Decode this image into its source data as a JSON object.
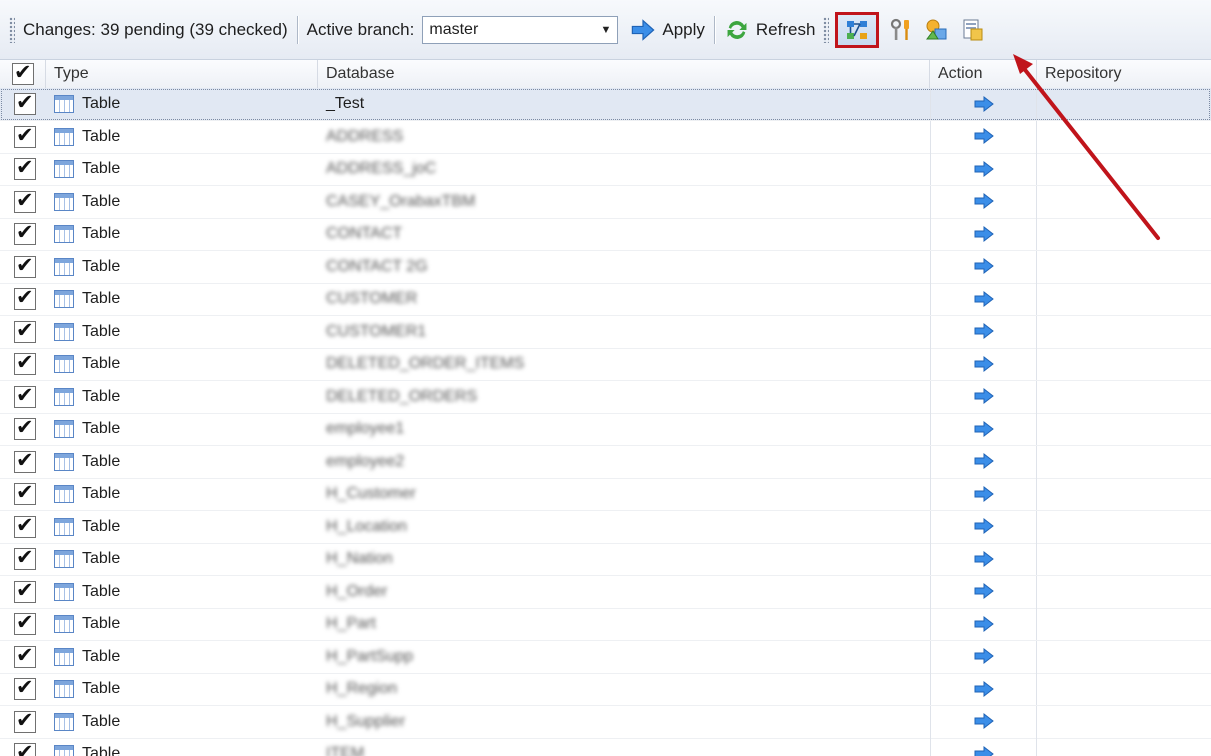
{
  "toolbar": {
    "changes_label": "Changes: 39 pending (39 checked)",
    "branch_label": "Active branch:",
    "branch_value": "master",
    "apply_label": "Apply",
    "refresh_label": "Refresh",
    "icons": [
      "arrow-right-icon",
      "refresh-icon",
      "branch-diagram-icon",
      "tools-icon",
      "shapes-icon",
      "document-icon"
    ]
  },
  "grid": {
    "columns": [
      "Type",
      "Database",
      "Action",
      "Repository"
    ],
    "rows": [
      {
        "type": "Table",
        "database": "_Test"
      },
      {
        "type": "Table",
        "database": "ADDRESS"
      },
      {
        "type": "Table",
        "database": "ADDRESS_joC"
      },
      {
        "type": "Table",
        "database": "CASEY_OrabaxTBM"
      },
      {
        "type": "Table",
        "database": "CONTACT"
      },
      {
        "type": "Table",
        "database": "CONTACT 2G"
      },
      {
        "type": "Table",
        "database": "CUSTOMER"
      },
      {
        "type": "Table",
        "database": "CUSTOMER1"
      },
      {
        "type": "Table",
        "database": "DELETED_ORDER_ITEMS"
      },
      {
        "type": "Table",
        "database": "DELETED_ORDERS"
      },
      {
        "type": "Table",
        "database": "employee1"
      },
      {
        "type": "Table",
        "database": "employee2"
      },
      {
        "type": "Table",
        "database": "H_Customer"
      },
      {
        "type": "Table",
        "database": "H_Location"
      },
      {
        "type": "Table",
        "database": "H_Nation"
      },
      {
        "type": "Table",
        "database": "H_Order"
      },
      {
        "type": "Table",
        "database": "H_Part"
      },
      {
        "type": "Table",
        "database": "H_PartSupp"
      },
      {
        "type": "Table",
        "database": "H_Region"
      },
      {
        "type": "Table",
        "database": "H_Supplier"
      },
      {
        "type": "Table",
        "database": "ITEM"
      }
    ]
  },
  "colors": {
    "highlight_box": "#c0141b",
    "annotation_arrow": "#c0141b",
    "action_arrow": "#3b8ee8",
    "selected_row": "#e1e8f3"
  }
}
